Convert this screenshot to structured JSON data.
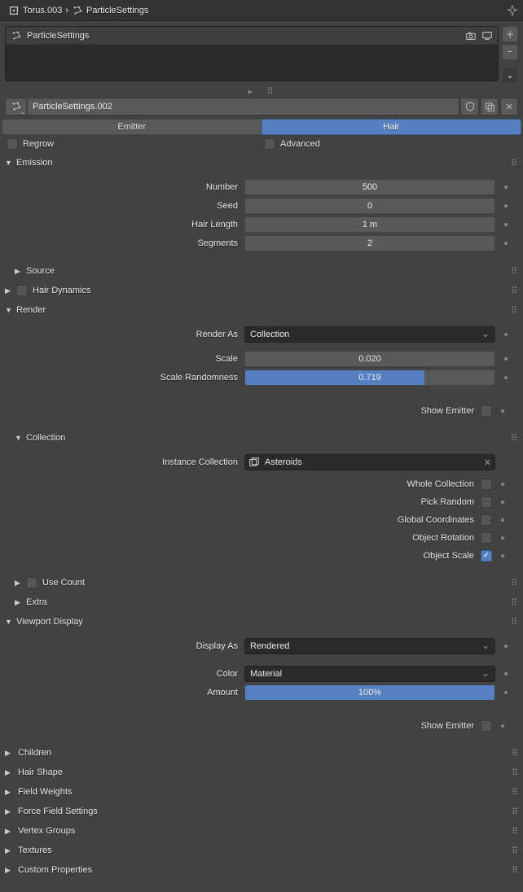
{
  "breadcrumb": {
    "obj": "Torus.003",
    "ps": "ParticleSettings"
  },
  "list": {
    "active": "ParticleSettings"
  },
  "datablock": {
    "name": "ParticleSettings.002"
  },
  "tabs": {
    "emitter": "Emitter",
    "hair": "Hair"
  },
  "opts": {
    "regrow": "Regrow",
    "advanced": "Advanced"
  },
  "emission": {
    "title": "Emission",
    "number_label": "Number",
    "number": "500",
    "seed_label": "Seed",
    "seed": "0",
    "hairlen_label": "Hair Length",
    "hairlen": "1 m",
    "segments_label": "Segments",
    "segments": "2"
  },
  "source": {
    "title": "Source"
  },
  "hairdyn": {
    "title": "Hair Dynamics"
  },
  "render": {
    "title": "Render",
    "renderas_label": "Render As",
    "renderas": "Collection",
    "scale_label": "Scale",
    "scale": "0.020",
    "scalerand_label": "Scale Randomness",
    "scalerand": "0.719",
    "scalerand_pct": 71.9,
    "showemitter_label": "Show Emitter"
  },
  "collection": {
    "title": "Collection",
    "instcoll_label": "Instance Collection",
    "instcoll": "Asteroids",
    "whole": "Whole Collection",
    "pick": "Pick Random",
    "global": "Global Coordinates",
    "objrot": "Object Rotation",
    "objscale": "Object Scale"
  },
  "usecount": {
    "title": "Use Count"
  },
  "extra": {
    "title": "Extra"
  },
  "viewport": {
    "title": "Viewport Display",
    "displayas_label": "Display As",
    "displayas": "Rendered",
    "color_label": "Color",
    "color": "Material",
    "amount_label": "Amount",
    "amount": "100%",
    "amount_pct": 100,
    "showemitter_label": "Show Emitter"
  },
  "closed": {
    "children": "Children",
    "hairshape": "Hair Shape",
    "fieldweights": "Field Weights",
    "forcefield": "Force Field Settings",
    "vg": "Vertex Groups",
    "tex": "Textures",
    "custom": "Custom Properties"
  }
}
